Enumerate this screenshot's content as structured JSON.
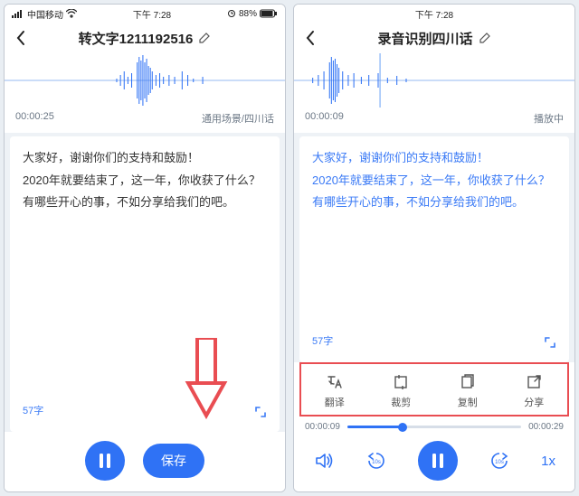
{
  "left": {
    "statusbar": {
      "carrier": "中国移动",
      "time": "下午 7:28",
      "battery": "88%"
    },
    "nav": {
      "title": "转文字1211192516"
    },
    "time_elapsed": "00:00:25",
    "scene_label": "通用场景/四川话",
    "transcript": "大家好，谢谢你们的支持和鼓励！\n2020年就要结束了，这一年，你收获了什么？有哪些开心的事，不如分享给我们的吧。",
    "char_count": "57字",
    "save_label": "保存"
  },
  "right": {
    "statusbar": {
      "time": "下午 7:28"
    },
    "nav": {
      "title": "录音识别四川话"
    },
    "time_elapsed": "00:00:09",
    "play_state": "播放中",
    "transcript": "大家好，谢谢你们的支持和鼓励！\n2020年就要结束了，这一年，你收获了什么？有哪些开心的事，不如分享给我们的吧。",
    "char_count": "57字",
    "tools": {
      "translate": "翻译",
      "trim": "裁剪",
      "copy": "复制",
      "share": "分享"
    },
    "progress": {
      "current": "00:00:09",
      "total": "00:00:29"
    },
    "rate": "1x",
    "skip_back": "10s",
    "skip_fwd": "10s"
  }
}
